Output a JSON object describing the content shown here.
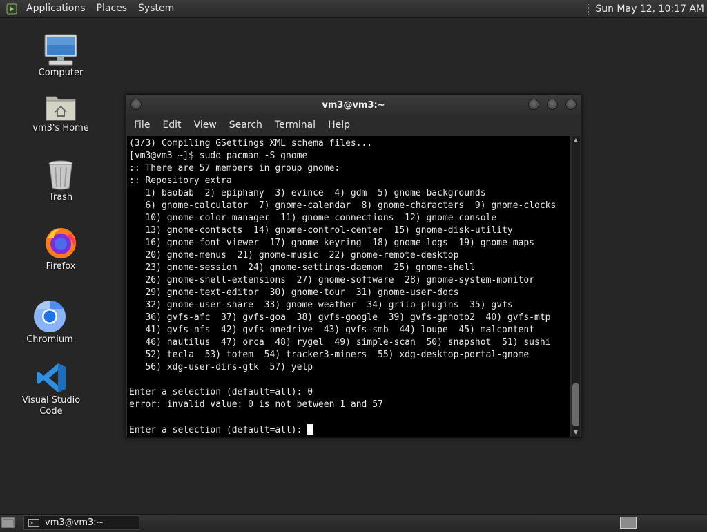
{
  "top_panel": {
    "menus": [
      "Applications",
      "Places",
      "System"
    ],
    "clock": "Sun May 12, 10:17 AM"
  },
  "desktop_icons": [
    {
      "label": "Computer",
      "icon": "computer-icon"
    },
    {
      "label": "vm3's Home",
      "icon": "home-folder-icon"
    },
    {
      "label": "Trash",
      "icon": "trash-icon"
    },
    {
      "label": "Firefox",
      "icon": "firefox-icon"
    },
    {
      "label": "Chromium",
      "icon": "chromium-icon"
    },
    {
      "label": "Visual Studio Code",
      "icon": "vscode-icon"
    }
  ],
  "terminal": {
    "title": "vm3@vm3:~",
    "menu": [
      "File",
      "Edit",
      "View",
      "Search",
      "Terminal",
      "Help"
    ],
    "lines": [
      "(3/3) Compiling GSettings XML schema files...",
      "[vm3@vm3 ~]$ sudo pacman -S gnome",
      ":: There are 57 members in group gnome:",
      ":: Repository extra",
      "   1) baobab  2) epiphany  3) evince  4) gdm  5) gnome-backgrounds",
      "   6) gnome-calculator  7) gnome-calendar  8) gnome-characters  9) gnome-clocks",
      "   10) gnome-color-manager  11) gnome-connections  12) gnome-console",
      "   13) gnome-contacts  14) gnome-control-center  15) gnome-disk-utility",
      "   16) gnome-font-viewer  17) gnome-keyring  18) gnome-logs  19) gnome-maps",
      "   20) gnome-menus  21) gnome-music  22) gnome-remote-desktop",
      "   23) gnome-session  24) gnome-settings-daemon  25) gnome-shell",
      "   26) gnome-shell-extensions  27) gnome-software  28) gnome-system-monitor",
      "   29) gnome-text-editor  30) gnome-tour  31) gnome-user-docs",
      "   32) gnome-user-share  33) gnome-weather  34) grilo-plugins  35) gvfs",
      "   36) gvfs-afc  37) gvfs-goa  38) gvfs-google  39) gvfs-gphoto2  40) gvfs-mtp",
      "   41) gvfs-nfs  42) gvfs-onedrive  43) gvfs-smb  44) loupe  45) malcontent",
      "   46) nautilus  47) orca  48) rygel  49) simple-scan  50) snapshot  51) sushi",
      "   52) tecla  53) totem  54) tracker3-miners  55) xdg-desktop-portal-gnome",
      "   56) xdg-user-dirs-gtk  57) yelp",
      "",
      "Enter a selection (default=all): 0",
      "error: invalid value: 0 is not between 1 and 57",
      ""
    ],
    "prompt": "Enter a selection (default=all): "
  },
  "taskbar": {
    "task_label": "vm3@vm3:~"
  }
}
